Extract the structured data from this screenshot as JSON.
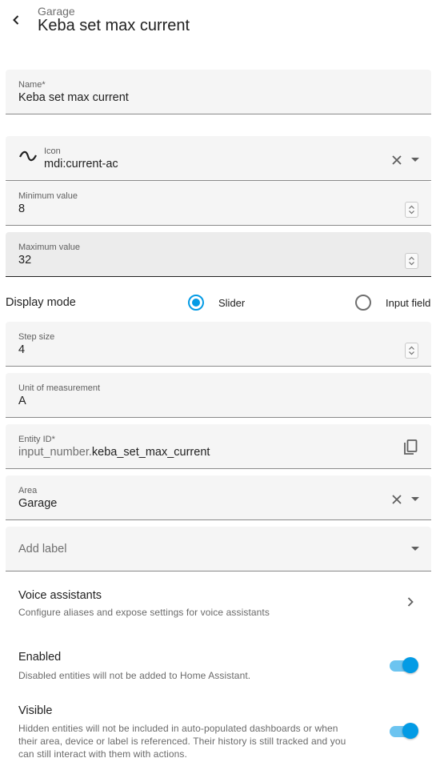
{
  "header": {
    "breadcrumb": "Garage",
    "title": "Keba set max current"
  },
  "fields": {
    "name": {
      "label": "Name*",
      "value": "Keba set max current"
    },
    "icon": {
      "label": "Icon",
      "value": "mdi:current-ac",
      "icon_name": "current-ac-icon"
    },
    "min": {
      "label": "Minimum value",
      "value": "8"
    },
    "max": {
      "label": "Maximum value",
      "value": "32"
    },
    "step": {
      "label": "Step size",
      "value": "4"
    },
    "unit": {
      "label": "Unit of measurement",
      "value": "A"
    },
    "entity_id": {
      "label": "Entity ID*",
      "prefix": "input_number.",
      "value": "keba_set_max_current"
    },
    "area": {
      "label": "Area",
      "value": "Garage"
    },
    "labels": {
      "placeholder": "Add label"
    }
  },
  "display_mode": {
    "label": "Display mode",
    "options": [
      "Slider",
      "Input field"
    ],
    "selected": "Slider"
  },
  "voice": {
    "title": "Voice assistants",
    "subtitle": "Configure aliases and expose settings for voice assistants"
  },
  "enabled": {
    "title": "Enabled",
    "subtitle": "Disabled entities will not be added to Home Assistant.",
    "on": true
  },
  "visible": {
    "title": "Visible",
    "subtitle_lines": [
      "Hidden entities will not be included in auto-populated dashboards or when",
      "their area, device or label is referenced. Their history is still tracked and you",
      "can still interact with them with actions."
    ],
    "on": true
  },
  "colors": {
    "accent": "#039be5",
    "field_bg": "#f5f5f5",
    "text": "#212121",
    "secondary_text": "#6a6a6a"
  }
}
